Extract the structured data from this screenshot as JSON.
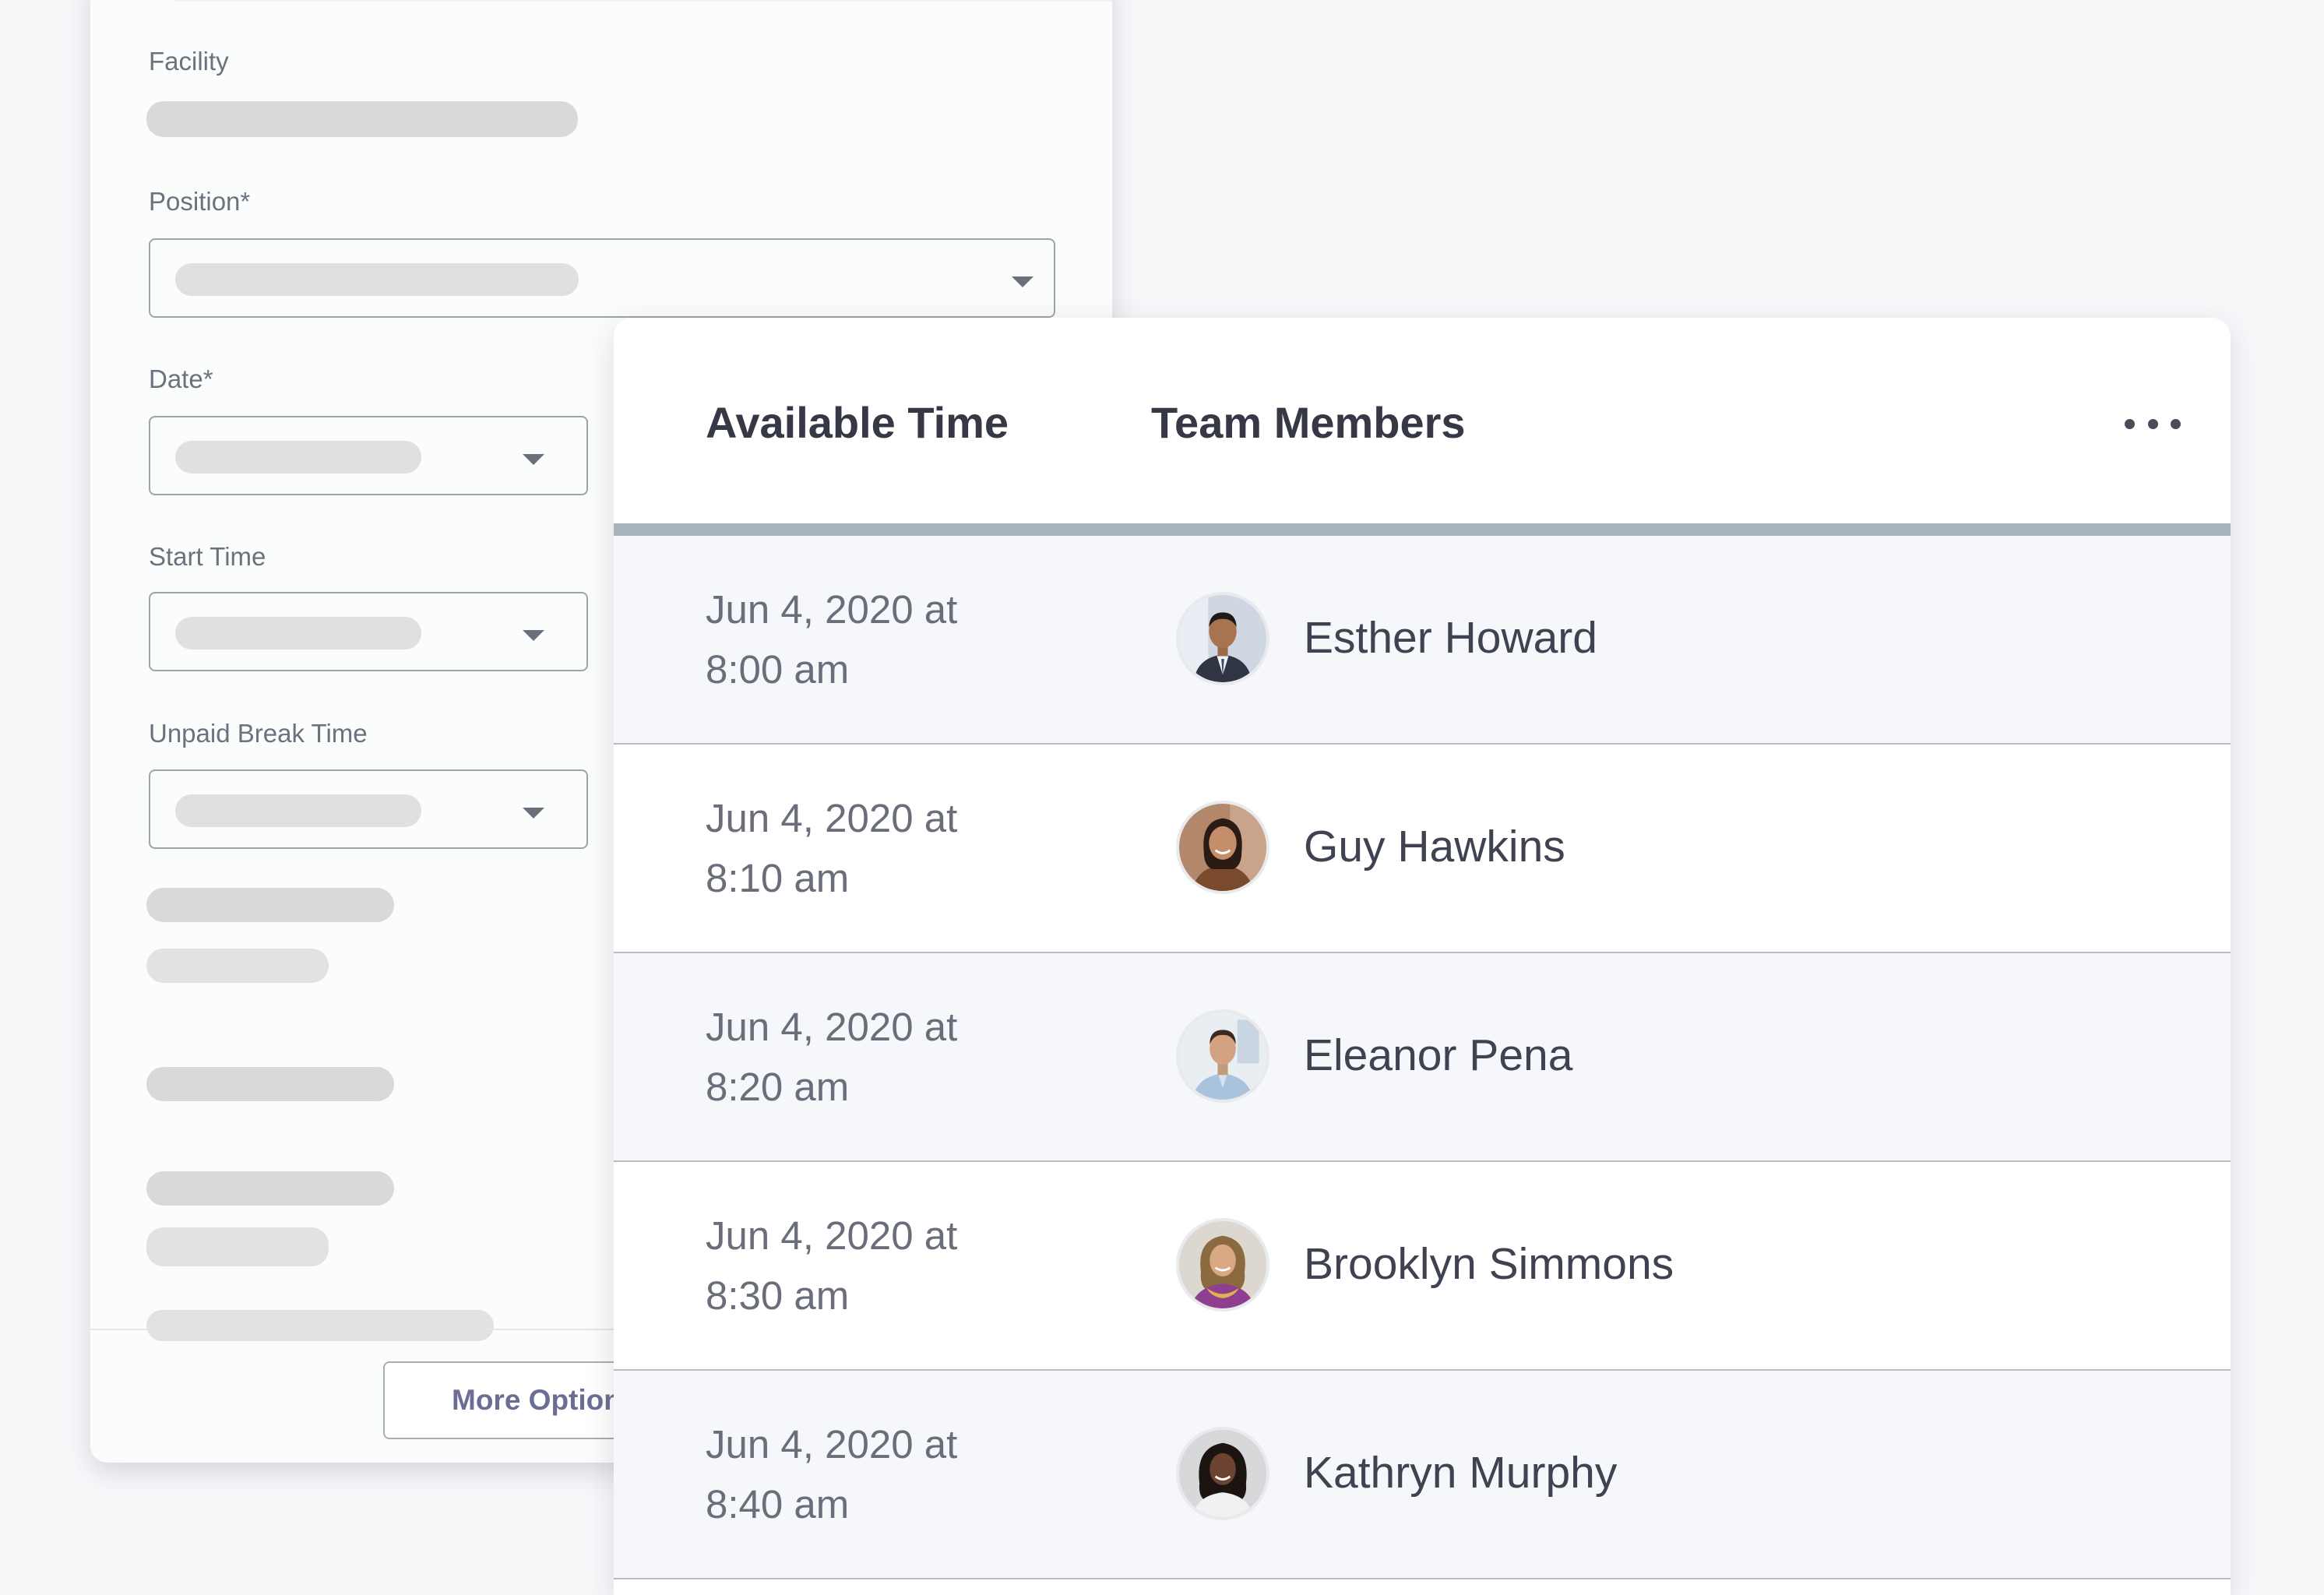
{
  "form": {
    "facility_label": "Facility",
    "position_label": "Position*",
    "date_label": "Date*",
    "start_time_label": "Start Time",
    "unpaid_break_label": "Unpaid Break Time",
    "more_options_label": "More Options"
  },
  "panel": {
    "available_time_header": "Available Time",
    "team_members_header": "Team Members",
    "more_menu_icon": "more-horizontal-icon",
    "rows": [
      {
        "time_line1": "Jun 4, 2020 at",
        "time_line2": "8:00 am",
        "name": "Esther Howard"
      },
      {
        "time_line1": "Jun 4, 2020 at",
        "time_line2": "8:10 am",
        "name": "Guy Hawkins"
      },
      {
        "time_line1": "Jun 4, 2020 at",
        "time_line2": "8:20 am",
        "name": "Eleanor Pena"
      },
      {
        "time_line1": "Jun 4, 2020 at",
        "time_line2": "8:30 am",
        "name": "Brooklyn Simmons"
      },
      {
        "time_line1": "Jun 4, 2020 at",
        "time_line2": "8:40 am",
        "name": "Kathryn Murphy"
      }
    ]
  },
  "colors": {
    "page_background": "#f7f8fa",
    "shaded_row": "#f6f7fa",
    "header_rule": "#a9b3bd",
    "button_text": "#6b6d94",
    "skeleton": "#d9d9d9"
  }
}
